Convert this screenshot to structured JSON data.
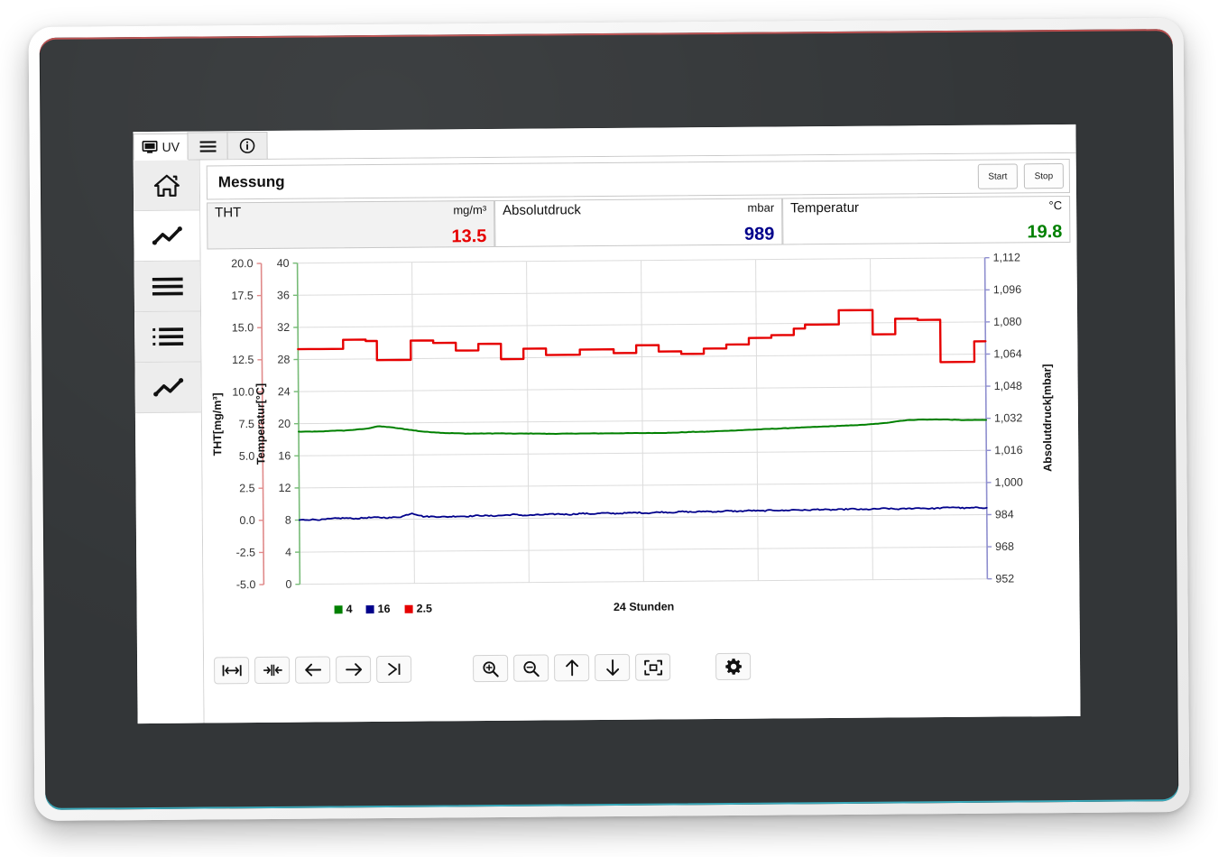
{
  "tabs": [
    {
      "id": "uv",
      "label": "UV",
      "icon": "monitor-icon",
      "active": true
    },
    {
      "id": "menu",
      "label": "",
      "icon": "hamburger-icon",
      "active": false
    },
    {
      "id": "info",
      "label": "",
      "icon": "info-circle-icon",
      "active": false
    }
  ],
  "sidebar": {
    "items": [
      {
        "id": "home",
        "icon": "home-icon",
        "active": false
      },
      {
        "id": "trend",
        "icon": "chart-line-icon",
        "active": true
      },
      {
        "id": "menu",
        "icon": "hamburger-icon",
        "active": false
      },
      {
        "id": "list",
        "icon": "list-icon",
        "active": false
      },
      {
        "id": "graph",
        "icon": "chart-line-icon",
        "active": false
      }
    ]
  },
  "titlebar": {
    "title": "Messung",
    "start_label": "Start",
    "stop_label": "Stop"
  },
  "values": [
    {
      "name": "THT",
      "unit": "mg/m³",
      "value": "13.5",
      "color": "#e60000",
      "shaded": true
    },
    {
      "name": "Absolutdruck",
      "unit": "mbar",
      "value": "989",
      "color": "#00008b",
      "shaded": false
    },
    {
      "name": "Temperatur",
      "unit": "°C",
      "value": "19.8",
      "color": "#008000",
      "shaded": false
    }
  ],
  "toolbar": {
    "buttons": [
      {
        "id": "fit-width",
        "icon": "fit-horizontal-icon",
        "glyph": "|↔|"
      },
      {
        "id": "split-center",
        "icon": "split-center-icon",
        "glyph": "⇥|⇤"
      },
      {
        "id": "scroll-left",
        "icon": "arrow-left-icon",
        "glyph": "←"
      },
      {
        "id": "scroll-right",
        "icon": "arrow-right-icon",
        "glyph": "→"
      },
      {
        "id": "goto-end",
        "icon": "goto-end-icon",
        "glyph": ">|"
      },
      {
        "id": "zoom-in",
        "icon": "zoom-in-icon",
        "glyph": "zoomin"
      },
      {
        "id": "zoom-out",
        "icon": "zoom-out-icon",
        "glyph": "zoomout"
      },
      {
        "id": "scroll-up",
        "icon": "arrow-up-icon",
        "glyph": "↑"
      },
      {
        "id": "scroll-down",
        "icon": "arrow-down-icon",
        "glyph": "↓"
      },
      {
        "id": "fit-all",
        "icon": "fit-all-icon",
        "glyph": "fitall"
      },
      {
        "id": "settings",
        "icon": "gear-icon",
        "glyph": "gear"
      }
    ]
  },
  "chart_data": {
    "type": "line",
    "title": "",
    "xlabel": "24 Stunden",
    "grid": true,
    "legend_position": "bottom-left",
    "legend": [
      {
        "label": "4",
        "color": "#008000",
        "series": "Temperatur"
      },
      {
        "label": "16",
        "color": "#00008b",
        "series": "Absolutdruck"
      },
      {
        "label": "2.5",
        "color": "#e60000",
        "series": "THT"
      }
    ],
    "axes": [
      {
        "id": "tht",
        "label": "THT[mg/m³]",
        "side": "left",
        "color": "#e08a8a",
        "ticks": [
          "20.0",
          "17.5",
          "15.0",
          "12.5",
          "10.0",
          "7.5",
          "5.0",
          "2.5",
          "0.0",
          "-2.5",
          "-5.0"
        ],
        "min": -5.0,
        "max": 20.0
      },
      {
        "id": "temperatur",
        "label": "Temperatur[°C]",
        "side": "left",
        "color": "#77bb77",
        "ticks": [
          "40",
          "36",
          "32",
          "28",
          "24",
          "20",
          "16",
          "12",
          "8",
          "4",
          "0"
        ],
        "min": 0,
        "max": 40
      },
      {
        "id": "absolutdruck",
        "label": "Absolutdruck[mbar]",
        "side": "right",
        "color": "#8f8fcf",
        "ticks": [
          "1,112",
          "1,096",
          "1,080",
          "1,064",
          "1,048",
          "1,032",
          "1,016",
          "1,000",
          "984",
          "968",
          "952"
        ],
        "min": 952,
        "max": 1112
      }
    ],
    "series": [
      {
        "name": "THT",
        "color": "#e60000",
        "axis": "tht",
        "width": 2.4,
        "style": "step",
        "values": [
          13.3,
          13.3,
          13.3,
          13.3,
          14.0,
          14.0,
          13.9,
          12.4,
          12.4,
          12.4,
          13.9,
          13.9,
          13.7,
          13.7,
          13.1,
          13.1,
          13.6,
          13.6,
          12.4,
          12.4,
          13.2,
          13.2,
          12.7,
          12.7,
          12.7,
          13.1,
          13.1,
          13.1,
          12.8,
          12.8,
          13.4,
          13.4,
          12.9,
          12.9,
          12.7,
          12.7,
          13.1,
          13.1,
          13.4,
          13.4,
          13.9,
          13.9,
          14.1,
          14.1,
          14.6,
          14.9,
          14.9,
          14.9,
          16.0,
          16.0,
          16.0,
          14.1,
          14.1,
          15.3,
          15.3,
          15.2,
          15.2,
          11.9,
          11.9,
          11.9,
          13.5,
          13.5
        ]
      },
      {
        "name": "Temperatur",
        "color": "#008000",
        "axis": "temperatur",
        "width": 2.0,
        "style": "smooth",
        "values": [
          19.0,
          19.0,
          19.0,
          19.1,
          19.1,
          19.2,
          19.3,
          19.6,
          19.5,
          19.3,
          19.1,
          18.9,
          18.8,
          18.7,
          18.65,
          18.6,
          18.6,
          18.6,
          18.6,
          18.55,
          18.55,
          18.55,
          18.5,
          18.5,
          18.5,
          18.5,
          18.5,
          18.5,
          18.5,
          18.5,
          18.5,
          18.5,
          18.5,
          18.5,
          18.55,
          18.6,
          18.6,
          18.65,
          18.7,
          18.75,
          18.8,
          18.85,
          18.9,
          18.95,
          19.0,
          19.05,
          19.1,
          19.15,
          19.2,
          19.25,
          19.3,
          19.4,
          19.5,
          19.7,
          19.85,
          19.9,
          19.9,
          19.9,
          19.85,
          19.8,
          19.8,
          19.8
        ]
      },
      {
        "name": "Absolutdruck",
        "color": "#00008b",
        "axis": "absolutdruck",
        "width": 1.8,
        "style": "noisy",
        "values": [
          984.0,
          984.2,
          984.1,
          984.6,
          984.8,
          984.5,
          984.9,
          985.0,
          984.8,
          985.2,
          987.0,
          985.3,
          985.2,
          985.0,
          985.3,
          985.2,
          985.6,
          985.3,
          985.5,
          985.9,
          985.4,
          985.6,
          985.8,
          986.0,
          985.7,
          986.2,
          985.9,
          986.3,
          986.0,
          986.2,
          986.4,
          986.1,
          986.6,
          986.3,
          986.7,
          986.4,
          986.8,
          986.5,
          986.9,
          986.6,
          987.0,
          986.7,
          987.1,
          986.8,
          987.2,
          986.9,
          987.3,
          987.0,
          987.1,
          987.4,
          987.0,
          987.2,
          987.5,
          987.1,
          987.3,
          987.6,
          987.2,
          987.5,
          987.9,
          987.3,
          987.5,
          987.4
        ]
      }
    ]
  }
}
